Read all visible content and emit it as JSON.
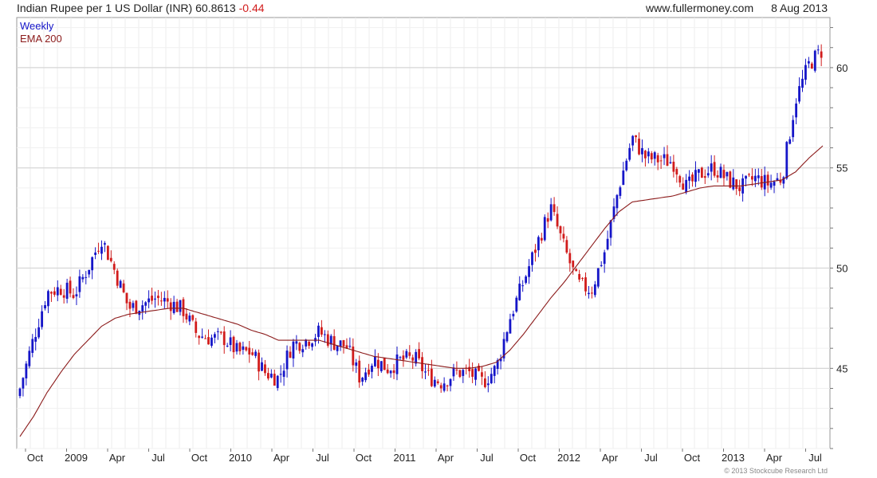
{
  "header": {
    "title": "Indian Rupee per 1 US Dollar (INR)",
    "price": "60.8613",
    "change": "-0.44",
    "site": "www.fullermoney.com",
    "date": "8 Aug 2013"
  },
  "footer": "© 2013 Stockcube Research Ltd",
  "colors": {
    "up": "#1515c8",
    "down": "#d11c1c",
    "ema": "#8b1a1a",
    "grid": "#d6d6d6"
  },
  "chart_data": {
    "type": "line",
    "title": "Indian Rupee per 1 US Dollar (INR)",
    "xlabel": "",
    "ylabel": "",
    "ylim": [
      41.0,
      62.5
    ],
    "y_ticks": [
      45,
      50,
      55,
      60
    ],
    "x_tick_labels": [
      "Oct",
      "2009",
      "Apr",
      "Jul",
      "Oct",
      "2010",
      "Apr",
      "Jul",
      "Oct",
      "2011",
      "Apr",
      "Jul",
      "Oct",
      "2012",
      "Apr",
      "Jul",
      "Oct",
      "2013",
      "Apr",
      "Jul"
    ],
    "legend": "top-left",
    "grid": true,
    "series": [
      {
        "name": "Weekly",
        "style": "candlestick",
        "x": [
          "2008-09",
          "2008-10",
          "2008-11",
          "2008-12",
          "2009-01",
          "2009-02",
          "2009-03",
          "2009-04",
          "2009-05",
          "2009-06",
          "2009-07",
          "2009-08",
          "2009-09",
          "2009-10",
          "2009-11",
          "2009-12",
          "2010-01",
          "2010-02",
          "2010-03",
          "2010-04",
          "2010-05",
          "2010-06",
          "2010-07",
          "2010-08",
          "2010-09",
          "2010-10",
          "2010-11",
          "2010-12",
          "2011-01",
          "2011-02",
          "2011-03",
          "2011-04",
          "2011-05",
          "2011-06",
          "2011-07",
          "2011-08",
          "2011-09",
          "2011-10",
          "2011-11",
          "2011-12",
          "2012-01",
          "2012-02",
          "2012-03",
          "2012-04",
          "2012-05",
          "2012-06",
          "2012-07",
          "2012-08",
          "2012-09",
          "2012-10",
          "2012-11",
          "2012-12",
          "2013-01",
          "2013-02",
          "2013-03",
          "2013-04",
          "2013-05",
          "2013-06",
          "2013-07",
          "2013-08"
        ],
        "values": [
          44.0,
          46.5,
          48.8,
          49.0,
          48.7,
          50.0,
          51.5,
          49.8,
          48.0,
          48.2,
          48.5,
          48.3,
          47.9,
          46.7,
          46.5,
          46.5,
          45.8,
          45.8,
          44.8,
          44.5,
          46.2,
          46.4,
          46.8,
          46.3,
          46.1,
          44.5,
          45.5,
          45.0,
          45.4,
          45.5,
          44.6,
          44.3,
          44.8,
          44.8,
          44.3,
          45.0,
          47.5,
          49.3,
          51.2,
          53.0,
          51.0,
          49.2,
          48.9,
          50.9,
          54.0,
          56.5,
          55.5,
          55.4,
          55.3,
          54.0,
          54.7,
          55.0,
          54.4,
          54.0,
          54.5,
          54.2,
          54.5,
          58.4,
          60.2,
          60.9
        ]
      },
      {
        "name": "EMA 200",
        "style": "line",
        "x": [
          "2008-09",
          "2008-10",
          "2008-11",
          "2008-12",
          "2009-01",
          "2009-02",
          "2009-03",
          "2009-04",
          "2009-05",
          "2009-06",
          "2009-07",
          "2009-08",
          "2009-09",
          "2009-10",
          "2009-11",
          "2009-12",
          "2010-01",
          "2010-02",
          "2010-03",
          "2010-04",
          "2010-05",
          "2010-06",
          "2010-07",
          "2010-08",
          "2010-09",
          "2010-10",
          "2010-11",
          "2010-12",
          "2011-01",
          "2011-02",
          "2011-03",
          "2011-04",
          "2011-05",
          "2011-06",
          "2011-07",
          "2011-08",
          "2011-09",
          "2011-10",
          "2011-11",
          "2011-12",
          "2012-01",
          "2012-02",
          "2012-03",
          "2012-04",
          "2012-05",
          "2012-06",
          "2012-07",
          "2012-08",
          "2012-09",
          "2012-10",
          "2012-11",
          "2012-12",
          "2013-01",
          "2013-02",
          "2013-03",
          "2013-04",
          "2013-05",
          "2013-06",
          "2013-07",
          "2013-08"
        ],
        "values": [
          41.6,
          42.6,
          43.8,
          44.8,
          45.7,
          46.4,
          47.1,
          47.5,
          47.7,
          47.8,
          47.9,
          48.0,
          48.0,
          47.8,
          47.6,
          47.4,
          47.2,
          46.9,
          46.7,
          46.4,
          46.4,
          46.4,
          46.4,
          46.2,
          46.0,
          45.8,
          45.6,
          45.5,
          45.4,
          45.3,
          45.2,
          45.1,
          45.0,
          45.0,
          45.1,
          45.3,
          45.9,
          46.7,
          47.6,
          48.5,
          49.3,
          50.2,
          51.1,
          52.0,
          52.8,
          53.3,
          53.4,
          53.5,
          53.6,
          53.8,
          54.0,
          54.1,
          54.1,
          54.1,
          54.2,
          54.3,
          54.4,
          54.8,
          55.5,
          56.1
        ]
      }
    ]
  }
}
